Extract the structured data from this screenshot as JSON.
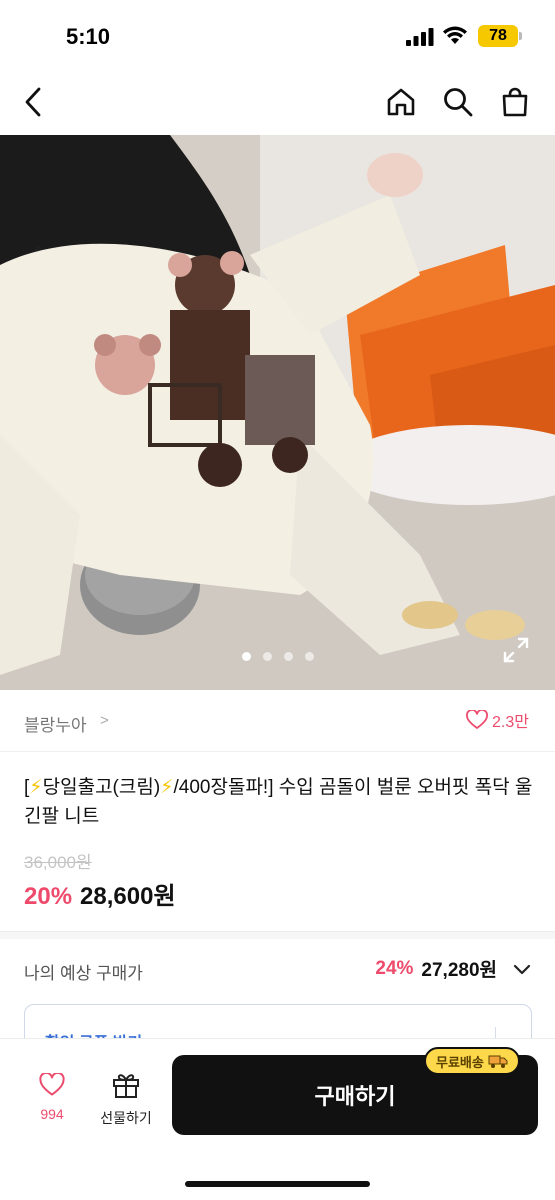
{
  "status": {
    "time": "5:10",
    "battery": "78"
  },
  "nav": {
    "back_icon": "back-chevron-icon",
    "home_icon": "home-icon",
    "search_icon": "search-icon",
    "cart_icon": "shopping-bag-icon"
  },
  "gallery": {
    "total_dots": 4,
    "active_index": 0
  },
  "brand": {
    "name": "블랑누아",
    "arrow": ">",
    "likes": "2.3만"
  },
  "product": {
    "title_prefix": "[",
    "title_part1": "당일출고(크림)",
    "title_part2": "/400장돌파!] 수입 곰돌이 벌룬 오버핏 폭닥 울 긴팔 니트",
    "original_price": "36,000원",
    "discount": "20%",
    "price": "28,600원"
  },
  "expected": {
    "label": "나의 예상 구매가",
    "discount": "24%",
    "price": "27,280원"
  },
  "coupon": {
    "label": "할인 쿠폰 받기"
  },
  "bottom": {
    "like_count": "994",
    "gift_label": "선물하기",
    "buy_label": "구매하기",
    "free_shipping": "무료배송"
  },
  "colors": {
    "accent_pink": "#ee4a6b",
    "shipping_badge": "#fcd84a",
    "buy_button": "#111111"
  }
}
